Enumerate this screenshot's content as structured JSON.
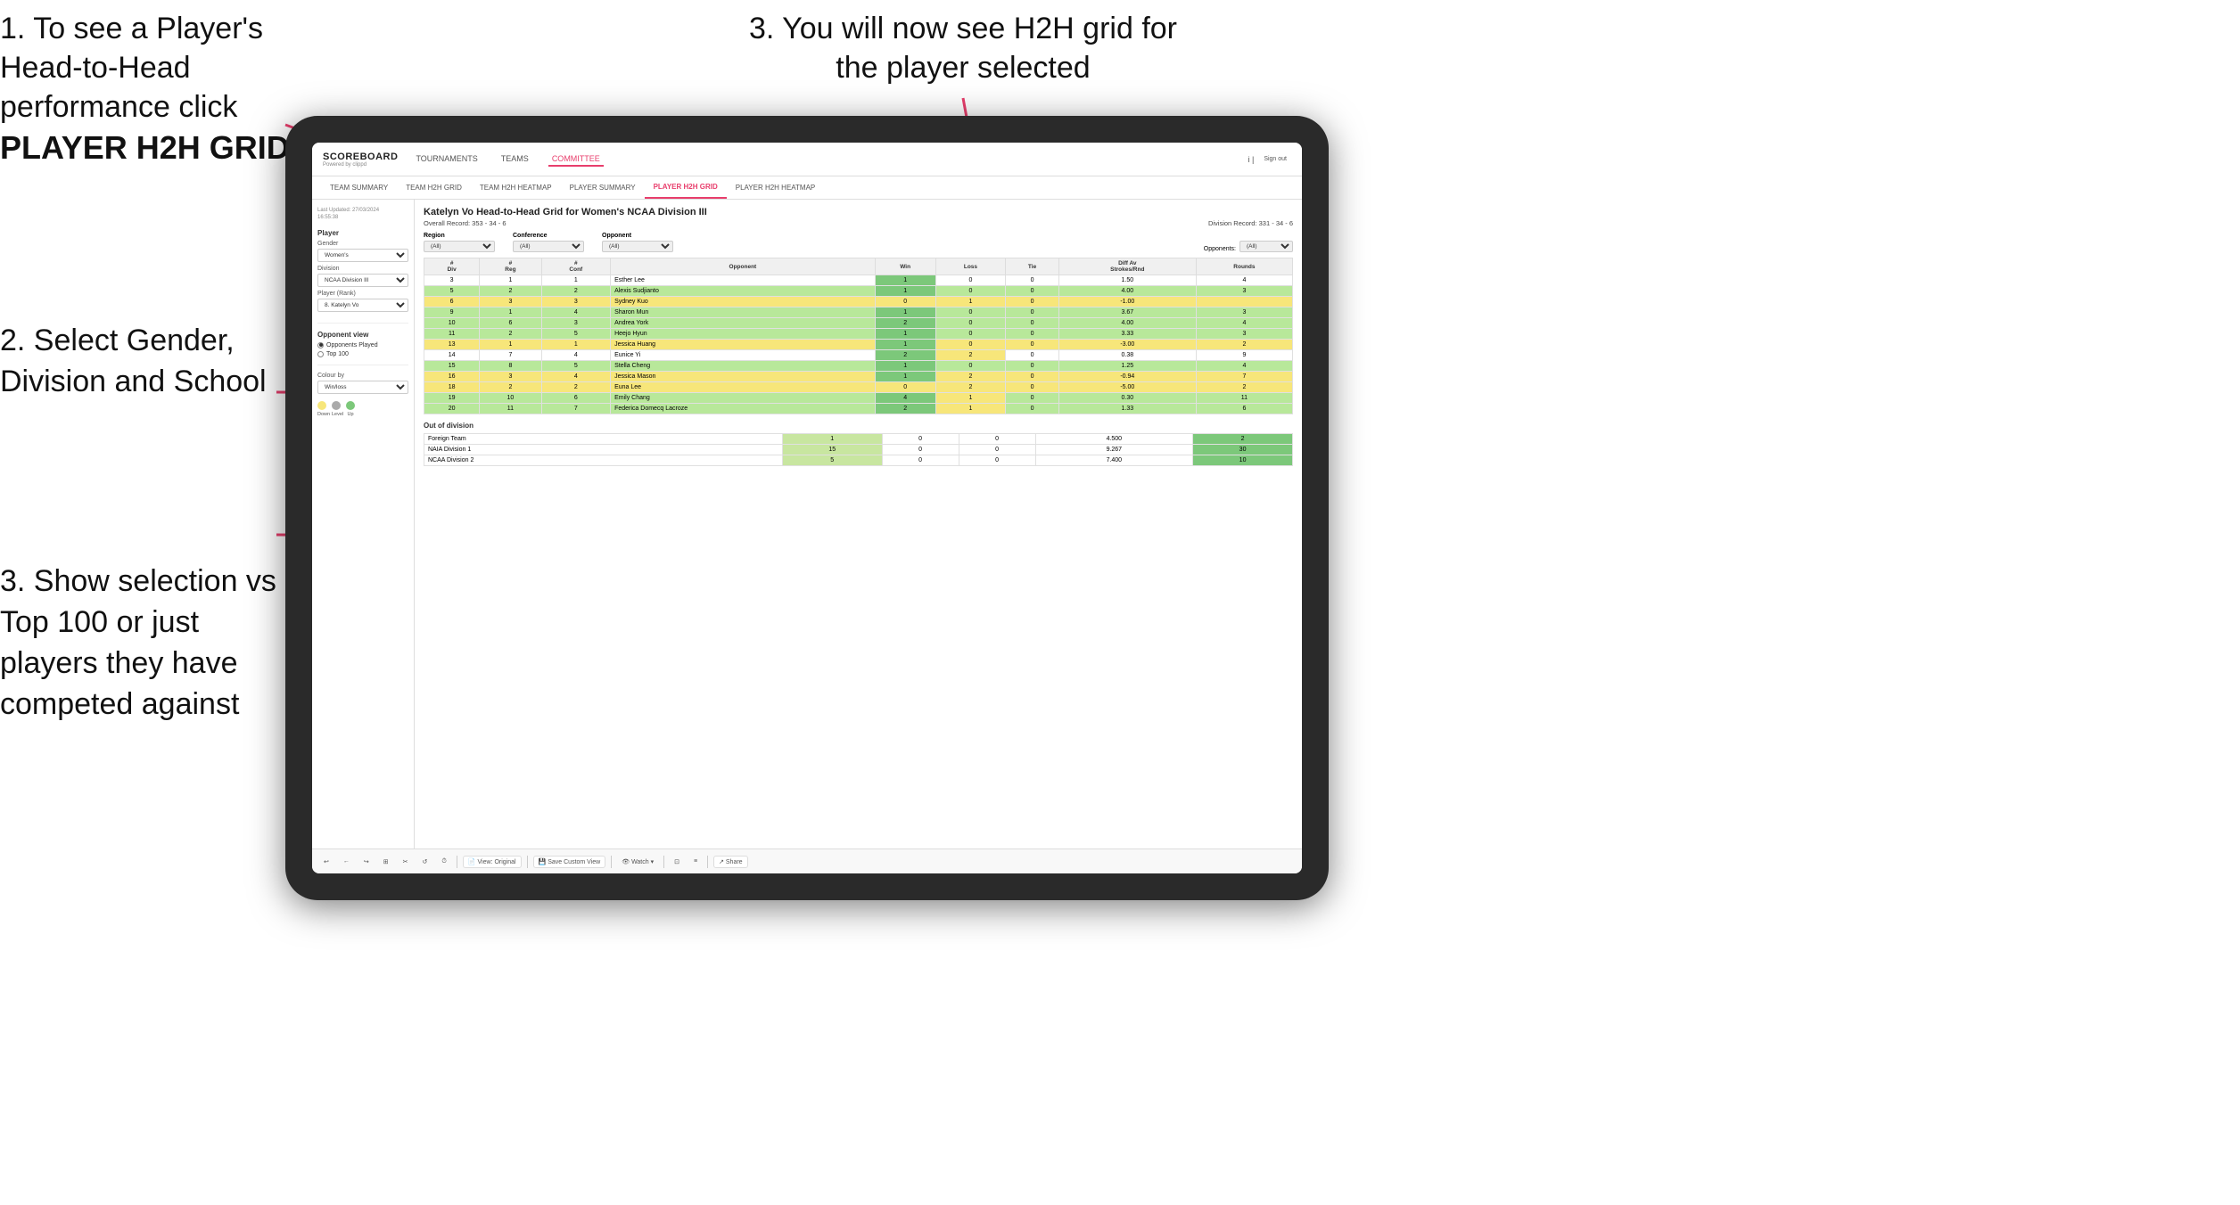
{
  "instructions": {
    "top_left_1": "1. To see a Player's Head-to-Head performance click",
    "top_left_2": "PLAYER H2H GRID",
    "top_right": "3. You will now see H2H grid for the player selected",
    "mid_left_title": "2. Select Gender, Division and School",
    "bottom_left_title": "3. Show selection vs Top 100 or just players they have competed against"
  },
  "nav": {
    "logo": "SCOREBOARD",
    "logo_sub": "Powered by clippd",
    "items": [
      "TOURNAMENTS",
      "TEAMS",
      "COMMITTEE"
    ],
    "active": "COMMITTEE",
    "sign_out": "Sign out"
  },
  "sub_nav": {
    "items": [
      "TEAM SUMMARY",
      "TEAM H2H GRID",
      "TEAM H2H HEATMAP",
      "PLAYER SUMMARY",
      "PLAYER H2H GRID",
      "PLAYER H2H HEATMAP"
    ],
    "active": "PLAYER H2H GRID"
  },
  "sidebar": {
    "timestamp": "Last Updated: 27/03/2024\n16:55:38",
    "player_section": "Player",
    "gender_label": "Gender",
    "gender_value": "Women's",
    "division_label": "Division",
    "division_value": "NCAA Division III",
    "player_rank_label": "Player (Rank)",
    "player_rank_value": "8. Katelyn Vo",
    "opponent_view_label": "Opponent view",
    "radio_options": [
      "Opponents Played",
      "Top 100"
    ],
    "selected_radio": "Opponents Played",
    "colour_by_label": "Colour by",
    "colour_by_value": "Win/loss",
    "colour_labels": [
      "Down",
      "Level",
      "Up"
    ],
    "colours": [
      "#f7e67a",
      "#aaaaaa",
      "#7cc87a"
    ]
  },
  "h2h": {
    "title": "Katelyn Vo Head-to-Head Grid for Women's NCAA Division III",
    "overall_record": "Overall Record: 353 - 34 - 6",
    "division_record": "Division Record: 331 - 34 - 6",
    "filter_region_label": "Region",
    "filter_conference_label": "Conference",
    "filter_opponent_label": "Opponent",
    "opponents_label": "Opponents:",
    "filter_all": "(All)",
    "columns": [
      "#\nDiv",
      "#\nReg",
      "#\nConf",
      "Opponent",
      "Win",
      "Loss",
      "Tie",
      "Diff Av\nStrokes/Rnd",
      "Rounds"
    ],
    "rows": [
      {
        "div": 3,
        "reg": 1,
        "conf": 1,
        "opponent": "Esther Lee",
        "win": 1,
        "loss": 0,
        "tie": 0,
        "diff": "1.50",
        "rounds": 4,
        "color": "white"
      },
      {
        "div": 5,
        "reg": 2,
        "conf": 2,
        "opponent": "Alexis Sudjianto",
        "win": 1,
        "loss": 0,
        "tie": 0,
        "diff": "4.00",
        "rounds": 3,
        "color": "green"
      },
      {
        "div": 6,
        "reg": 3,
        "conf": 3,
        "opponent": "Sydney Kuo",
        "win": 0,
        "loss": 1,
        "tie": 0,
        "diff": "-1.00",
        "rounds": "",
        "color": "yellow"
      },
      {
        "div": 9,
        "reg": 1,
        "conf": 4,
        "opponent": "Sharon Mun",
        "win": 1,
        "loss": 0,
        "tie": 0,
        "diff": "3.67",
        "rounds": 3,
        "color": "green"
      },
      {
        "div": 10,
        "reg": 6,
        "conf": 3,
        "opponent": "Andrea York",
        "win": 2,
        "loss": 0,
        "tie": 0,
        "diff": "4.00",
        "rounds": 4,
        "color": "green"
      },
      {
        "div": 11,
        "reg": 2,
        "conf": 5,
        "opponent": "Heejo Hyun",
        "win": 1,
        "loss": 0,
        "tie": 0,
        "diff": "3.33",
        "rounds": 3,
        "color": "green"
      },
      {
        "div": 13,
        "reg": 1,
        "conf": 1,
        "opponent": "Jessica Huang",
        "win": 1,
        "loss": 0,
        "tie": 0,
        "diff": "-3.00",
        "rounds": 2,
        "color": "yellow"
      },
      {
        "div": 14,
        "reg": 7,
        "conf": 4,
        "opponent": "Eunice Yi",
        "win": 2,
        "loss": 2,
        "tie": 0,
        "diff": "0.38",
        "rounds": 9,
        "color": "white"
      },
      {
        "div": 15,
        "reg": 8,
        "conf": 5,
        "opponent": "Stella Cheng",
        "win": 1,
        "loss": 0,
        "tie": 0,
        "diff": "1.25",
        "rounds": 4,
        "color": "green"
      },
      {
        "div": 16,
        "reg": 3,
        "conf": 4,
        "opponent": "Jessica Mason",
        "win": 1,
        "loss": 2,
        "tie": 0,
        "diff": "-0.94",
        "rounds": 7,
        "color": "yellow"
      },
      {
        "div": 18,
        "reg": 2,
        "conf": 2,
        "opponent": "Euna Lee",
        "win": 0,
        "loss": 2,
        "tie": 0,
        "diff": "-5.00",
        "rounds": 2,
        "color": "yellow"
      },
      {
        "div": 19,
        "reg": 10,
        "conf": 6,
        "opponent": "Emily Chang",
        "win": 4,
        "loss": 1,
        "tie": 0,
        "diff": "0.30",
        "rounds": 11,
        "color": "green"
      },
      {
        "div": 20,
        "reg": 11,
        "conf": 7,
        "opponent": "Federica Domecq Lacroze",
        "win": 2,
        "loss": 1,
        "tie": 0,
        "diff": "1.33",
        "rounds": 6,
        "color": "green"
      }
    ],
    "out_of_division_label": "Out of division",
    "out_rows": [
      {
        "name": "Foreign Team",
        "win": 1,
        "loss": 0,
        "tie": 0,
        "diff": "4.500",
        "rounds": 2,
        "color": "green"
      },
      {
        "name": "NAIA Division 1",
        "win": 15,
        "loss": 0,
        "tie": 0,
        "diff": "9.267",
        "rounds": 30,
        "color": "green"
      },
      {
        "name": "NCAA Division 2",
        "win": 5,
        "loss": 0,
        "tie": 0,
        "diff": "7.400",
        "rounds": 10,
        "color": "green"
      }
    ]
  },
  "toolbar": {
    "buttons": [
      "↩",
      "←",
      "↪",
      "⊞",
      "✂",
      "↺",
      "⏱",
      "View: Original",
      "Save Custom View",
      "👁 Watch ▾",
      "⊡",
      "≡",
      "Share"
    ]
  }
}
